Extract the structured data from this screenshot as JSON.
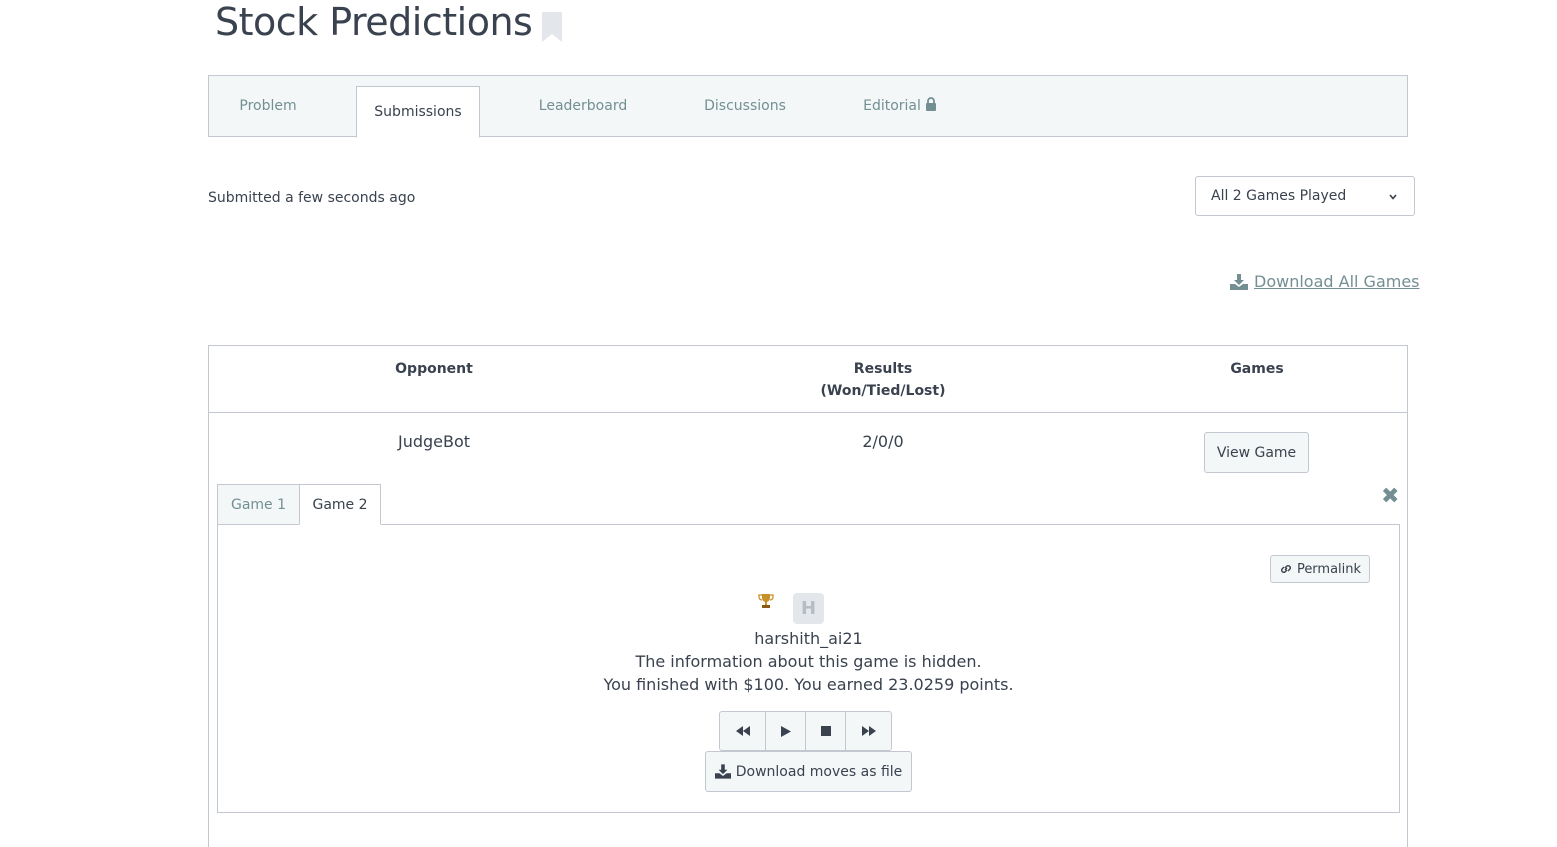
{
  "page": {
    "title": "Stock Predictions",
    "bookmark_icon": "bookmark-icon"
  },
  "tabs": [
    {
      "label": "Problem",
      "active": false
    },
    {
      "label": "Submissions",
      "active": true
    },
    {
      "label": "Leaderboard",
      "active": false
    },
    {
      "label": "Discussions",
      "active": false
    },
    {
      "label": "Editorial",
      "active": false,
      "icon": "lock-icon"
    }
  ],
  "submission": {
    "status": "Submitted a few seconds ago",
    "games_filter": {
      "selected": "All 2 Games Played"
    },
    "download_all_label": "Download All Games"
  },
  "results_table": {
    "headers": {
      "opponent": "Opponent",
      "results_line1": "Results",
      "results_line2": "(Won/Tied/Lost)",
      "games": "Games"
    },
    "rows": [
      {
        "opponent": "JudgeBot",
        "results": "2/0/0",
        "games_button": "View Game"
      }
    ]
  },
  "game_viewer": {
    "tabs": [
      {
        "label": "Game 1",
        "active": false
      },
      {
        "label": "Game 2",
        "active": true
      }
    ],
    "permalink_label": "Permalink",
    "avatar_letter": "H",
    "username": "harshith_ai21",
    "info": "The information about this game is hidden.",
    "earned": "You finished with $100. You earned 23.0259 points.",
    "controls": [
      "rewind-icon",
      "play-icon",
      "stop-icon",
      "fast-forward-icon"
    ],
    "download_moves_label": "Download moves as file"
  },
  "colors": {
    "text": "#39424e",
    "muted": "#738f93",
    "border": "#c2c7d0",
    "tab_bg": "#f3f7f7",
    "trophy": "#c9902a"
  }
}
